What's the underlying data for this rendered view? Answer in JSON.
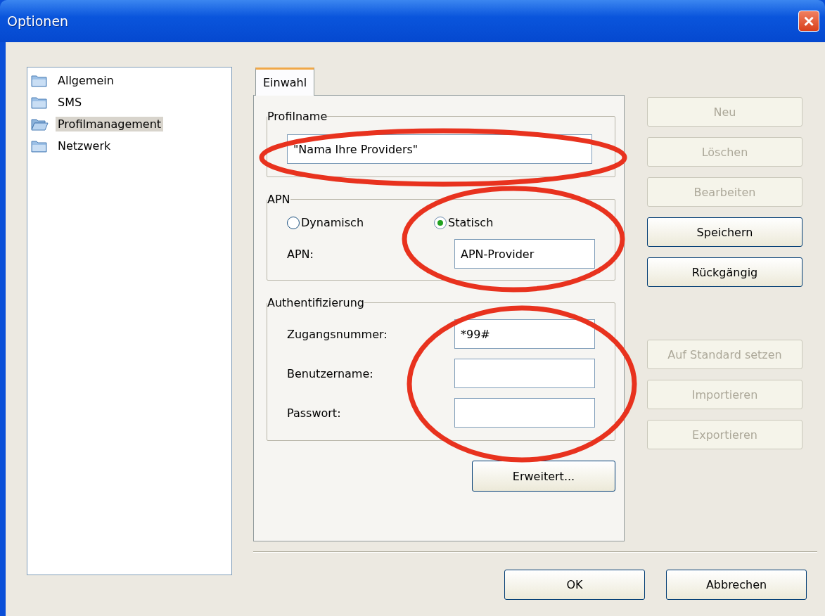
{
  "window": {
    "title": "Optionen",
    "close": "×"
  },
  "sidebar": {
    "items": [
      {
        "label": "Allgemein",
        "selected": false
      },
      {
        "label": "SMS",
        "selected": false
      },
      {
        "label": "Profilmanagement",
        "selected": true
      },
      {
        "label": "Netzwerk",
        "selected": false
      }
    ]
  },
  "tabs": [
    {
      "label": "Einwahl",
      "selected": true
    }
  ],
  "profile_group": {
    "title": "Profilname",
    "value": "\"Nama Ihre Providers\""
  },
  "apn_group": {
    "title": "APN",
    "radios": [
      {
        "label": "Dynamisch",
        "selected": false
      },
      {
        "label": "Statisch",
        "selected": true
      }
    ],
    "field_label": "APN:",
    "value": "APN-Provider"
  },
  "auth_group": {
    "title": "Authentifizierung",
    "fields": [
      {
        "label": "Zugangsnummer:",
        "value": "*99#"
      },
      {
        "label": "Benutzername:"
      },
      {
        "label": "Passwort:"
      }
    ]
  },
  "advanced_button": {
    "label": "Erweitert..."
  },
  "side_button_groups": [
    [
      {
        "label": "Neu",
        "disabled": true
      },
      {
        "label": "Löschen",
        "disabled": true
      },
      {
        "label": "Bearbeiten",
        "disabled": true
      },
      {
        "label": "Speichern",
        "disabled": false
      },
      {
        "label": "Rückgängig",
        "disabled": false
      }
    ],
    [
      {
        "label": "Auf Standard setzen",
        "disabled": true
      },
      {
        "label": "Importieren",
        "disabled": true
      },
      {
        "label": "Exportieren",
        "disabled": true
      }
    ]
  ],
  "footer_buttons": [
    {
      "label": "OK"
    },
    {
      "label": "Abbrechen"
    }
  ]
}
